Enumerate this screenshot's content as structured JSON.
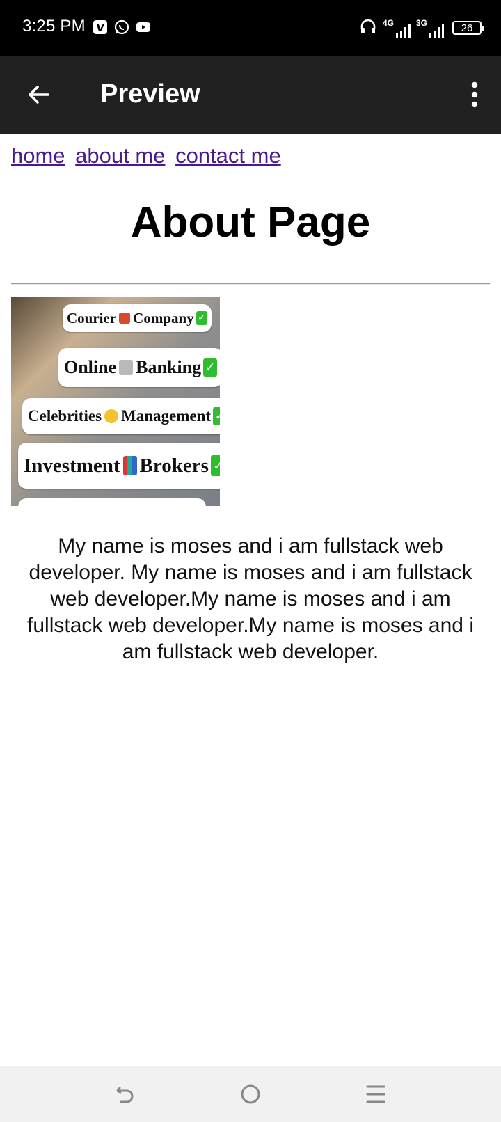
{
  "status_bar": {
    "time": "3:25 PM",
    "app_icons": [
      "vimeo-icon",
      "whatsapp-icon",
      "youtube-icon"
    ],
    "network_1": "4G",
    "network_2": "3G",
    "battery": "26"
  },
  "app_bar": {
    "title": "Preview"
  },
  "page": {
    "nav_links": [
      "home",
      "about me",
      "contact me"
    ],
    "heading": "About Page",
    "image": {
      "lines": [
        {
          "left": "Courier",
          "right": "Company"
        },
        {
          "left": "Online",
          "right": "Banking"
        },
        {
          "left": "Celebrities",
          "right": "Management"
        },
        {
          "left": "Investment",
          "right": "Brokers"
        }
      ]
    },
    "bio": "My name is moses and i am fullstack web developer. My name is moses and i am fullstack web developer.My name is moses and i am fullstack web developer.My name is moses and i am fullstack web developer."
  },
  "colors": {
    "status_bar_bg": "#000000",
    "app_bar_bg": "#212121",
    "link_color": "#4a1a8c",
    "nav_bar_bg": "#f1f1f1"
  }
}
